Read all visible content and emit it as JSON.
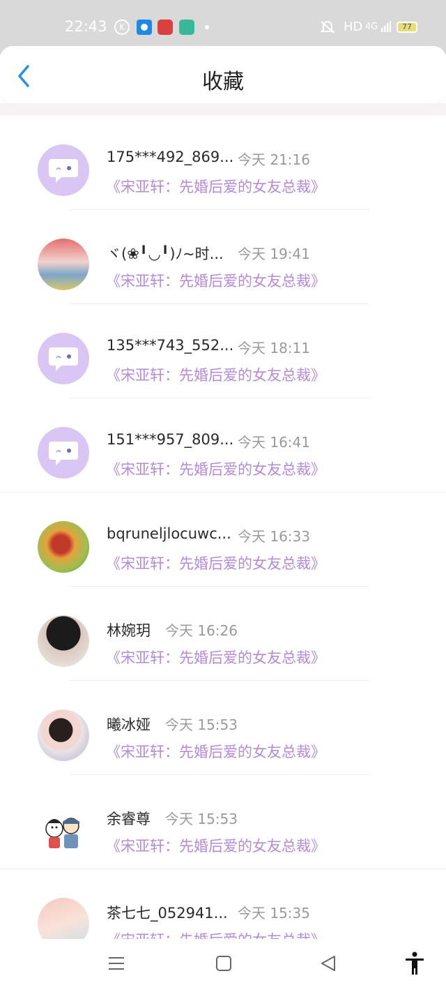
{
  "status_bar": {
    "time": "22:43",
    "hd_label": "HD",
    "signal_label": "4G",
    "battery_level": "77"
  },
  "header": {
    "title": "收藏"
  },
  "colors": {
    "accent_back": "#2b8ee8",
    "book_title": "#b58ad9",
    "avatar_default": "#d9c6f5"
  },
  "favorites": [
    {
      "name": "175***492_869...",
      "time": "今天 21:16",
      "book": "《宋亚轩：先婚后爱的女友总裁》",
      "avatar": "default-avatar"
    },
    {
      "name": "ヾ(❀╹◡╹)ﾉ~时...",
      "time": "今天 19:41",
      "book": "《宋亚轩：先婚后爱的女友总裁》",
      "avatar": "photo"
    },
    {
      "name": "135***743_552...",
      "time": "今天 18:11",
      "book": "《宋亚轩：先婚后爱的女友总裁》",
      "avatar": "default-avatar"
    },
    {
      "name": "151***957_809...",
      "time": "今天 16:41",
      "book": "《宋亚轩：先婚后爱的女友总裁》",
      "avatar": "default-avatar"
    },
    {
      "name": "bqruneljlocuwc...",
      "time": "今天 16:33",
      "book": "《宋亚轩：先婚后爱的女友总裁》",
      "avatar": "photo"
    },
    {
      "name": "林婉玥",
      "time": "今天 16:26",
      "book": "《宋亚轩：先婚后爱的女友总裁》",
      "avatar": "photo"
    },
    {
      "name": "曦冰娅",
      "time": "今天 15:53",
      "book": "《宋亚轩：先婚后爱的女友总裁》",
      "avatar": "photo"
    },
    {
      "name": "余睿尊",
      "time": "今天 15:53",
      "book": "《宋亚轩：先婚后爱的女友总裁》",
      "avatar": "cartoon"
    },
    {
      "name": "茶七七_052941...",
      "time": "今天 15:35",
      "book": "《宋亚轩：先婚后爱的女友总裁》",
      "avatar": "photo"
    }
  ],
  "nav": {
    "menu": "menu-icon",
    "home": "home-icon",
    "back": "back-icon",
    "accessibility": "accessibility-icon"
  }
}
